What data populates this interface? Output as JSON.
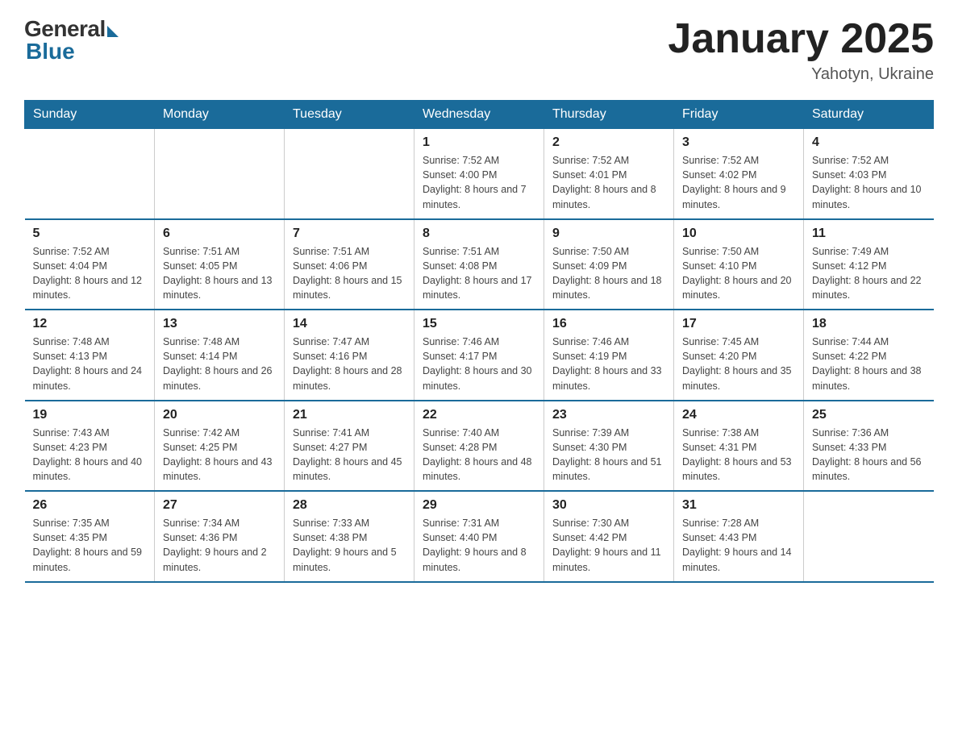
{
  "logo": {
    "general": "General",
    "blue": "Blue"
  },
  "title": "January 2025",
  "location": "Yahotyn, Ukraine",
  "days_of_week": [
    "Sunday",
    "Monday",
    "Tuesday",
    "Wednesday",
    "Thursday",
    "Friday",
    "Saturday"
  ],
  "weeks": [
    [
      {
        "day": "",
        "info": ""
      },
      {
        "day": "",
        "info": ""
      },
      {
        "day": "",
        "info": ""
      },
      {
        "day": "1",
        "info": "Sunrise: 7:52 AM\nSunset: 4:00 PM\nDaylight: 8 hours\nand 7 minutes."
      },
      {
        "day": "2",
        "info": "Sunrise: 7:52 AM\nSunset: 4:01 PM\nDaylight: 8 hours\nand 8 minutes."
      },
      {
        "day": "3",
        "info": "Sunrise: 7:52 AM\nSunset: 4:02 PM\nDaylight: 8 hours\nand 9 minutes."
      },
      {
        "day": "4",
        "info": "Sunrise: 7:52 AM\nSunset: 4:03 PM\nDaylight: 8 hours\nand 10 minutes."
      }
    ],
    [
      {
        "day": "5",
        "info": "Sunrise: 7:52 AM\nSunset: 4:04 PM\nDaylight: 8 hours\nand 12 minutes."
      },
      {
        "day": "6",
        "info": "Sunrise: 7:51 AM\nSunset: 4:05 PM\nDaylight: 8 hours\nand 13 minutes."
      },
      {
        "day": "7",
        "info": "Sunrise: 7:51 AM\nSunset: 4:06 PM\nDaylight: 8 hours\nand 15 minutes."
      },
      {
        "day": "8",
        "info": "Sunrise: 7:51 AM\nSunset: 4:08 PM\nDaylight: 8 hours\nand 17 minutes."
      },
      {
        "day": "9",
        "info": "Sunrise: 7:50 AM\nSunset: 4:09 PM\nDaylight: 8 hours\nand 18 minutes."
      },
      {
        "day": "10",
        "info": "Sunrise: 7:50 AM\nSunset: 4:10 PM\nDaylight: 8 hours\nand 20 minutes."
      },
      {
        "day": "11",
        "info": "Sunrise: 7:49 AM\nSunset: 4:12 PM\nDaylight: 8 hours\nand 22 minutes."
      }
    ],
    [
      {
        "day": "12",
        "info": "Sunrise: 7:48 AM\nSunset: 4:13 PM\nDaylight: 8 hours\nand 24 minutes."
      },
      {
        "day": "13",
        "info": "Sunrise: 7:48 AM\nSunset: 4:14 PM\nDaylight: 8 hours\nand 26 minutes."
      },
      {
        "day": "14",
        "info": "Sunrise: 7:47 AM\nSunset: 4:16 PM\nDaylight: 8 hours\nand 28 minutes."
      },
      {
        "day": "15",
        "info": "Sunrise: 7:46 AM\nSunset: 4:17 PM\nDaylight: 8 hours\nand 30 minutes."
      },
      {
        "day": "16",
        "info": "Sunrise: 7:46 AM\nSunset: 4:19 PM\nDaylight: 8 hours\nand 33 minutes."
      },
      {
        "day": "17",
        "info": "Sunrise: 7:45 AM\nSunset: 4:20 PM\nDaylight: 8 hours\nand 35 minutes."
      },
      {
        "day": "18",
        "info": "Sunrise: 7:44 AM\nSunset: 4:22 PM\nDaylight: 8 hours\nand 38 minutes."
      }
    ],
    [
      {
        "day": "19",
        "info": "Sunrise: 7:43 AM\nSunset: 4:23 PM\nDaylight: 8 hours\nand 40 minutes."
      },
      {
        "day": "20",
        "info": "Sunrise: 7:42 AM\nSunset: 4:25 PM\nDaylight: 8 hours\nand 43 minutes."
      },
      {
        "day": "21",
        "info": "Sunrise: 7:41 AM\nSunset: 4:27 PM\nDaylight: 8 hours\nand 45 minutes."
      },
      {
        "day": "22",
        "info": "Sunrise: 7:40 AM\nSunset: 4:28 PM\nDaylight: 8 hours\nand 48 minutes."
      },
      {
        "day": "23",
        "info": "Sunrise: 7:39 AM\nSunset: 4:30 PM\nDaylight: 8 hours\nand 51 minutes."
      },
      {
        "day": "24",
        "info": "Sunrise: 7:38 AM\nSunset: 4:31 PM\nDaylight: 8 hours\nand 53 minutes."
      },
      {
        "day": "25",
        "info": "Sunrise: 7:36 AM\nSunset: 4:33 PM\nDaylight: 8 hours\nand 56 minutes."
      }
    ],
    [
      {
        "day": "26",
        "info": "Sunrise: 7:35 AM\nSunset: 4:35 PM\nDaylight: 8 hours\nand 59 minutes."
      },
      {
        "day": "27",
        "info": "Sunrise: 7:34 AM\nSunset: 4:36 PM\nDaylight: 9 hours\nand 2 minutes."
      },
      {
        "day": "28",
        "info": "Sunrise: 7:33 AM\nSunset: 4:38 PM\nDaylight: 9 hours\nand 5 minutes."
      },
      {
        "day": "29",
        "info": "Sunrise: 7:31 AM\nSunset: 4:40 PM\nDaylight: 9 hours\nand 8 minutes."
      },
      {
        "day": "30",
        "info": "Sunrise: 7:30 AM\nSunset: 4:42 PM\nDaylight: 9 hours\nand 11 minutes."
      },
      {
        "day": "31",
        "info": "Sunrise: 7:28 AM\nSunset: 4:43 PM\nDaylight: 9 hours\nand 14 minutes."
      },
      {
        "day": "",
        "info": ""
      }
    ]
  ]
}
